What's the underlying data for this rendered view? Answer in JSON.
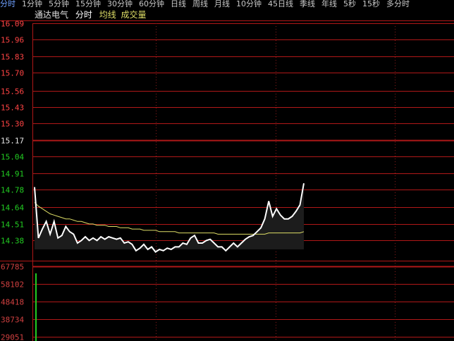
{
  "colors": {
    "grid": "#b01818",
    "dotted": "#8a1a1a",
    "price_up": "#ff4444",
    "price_down": "#22cc22",
    "ref": "#e8e8e8",
    "volume_tick": "#d04040",
    "price_line": "#ffffff",
    "avg_line": "#dddd66",
    "volume_bar": "#22cc22",
    "active_tab": "#6fa0ff"
  },
  "tabs": [
    "分时",
    "1分钟",
    "5分钟",
    "15分钟",
    "30分钟",
    "60分钟",
    "日线",
    "周线",
    "月线",
    "10分钟",
    "45日线",
    "季线",
    "年线",
    "5秒",
    "15秒",
    "多分时"
  ],
  "active_tab": 0,
  "legend": {
    "name": "通达电气",
    "mode": "分时",
    "avg": "均线",
    "vol": "成交量"
  },
  "chart_data": {
    "type": "line",
    "price_axis": {
      "ticks": [
        "16.09",
        "15.96",
        "15.83",
        "15.70",
        "15.56",
        "15.43",
        "15.30",
        "15.17",
        "15.04",
        "14.91",
        "14.78",
        "14.64",
        "14.51",
        "14.38"
      ],
      "reference_price": 15.17,
      "ylim": [
        14.31,
        16.09
      ]
    },
    "volume_axis": {
      "ticks": [
        "67785",
        "58102",
        "48418",
        "38734",
        "29051"
      ],
      "ylim": [
        0,
        67785
      ]
    },
    "price_series": {
      "name": "分时",
      "x_index": [
        0,
        1,
        2,
        3,
        4,
        5,
        6,
        7,
        8,
        9,
        10,
        11,
        12,
        13,
        14,
        15,
        16,
        17,
        18,
        19,
        20,
        21,
        22,
        23,
        24,
        25,
        26,
        27,
        28,
        29,
        30,
        31,
        32,
        33,
        34,
        35,
        36,
        37,
        38,
        39,
        40,
        41,
        42,
        43,
        44,
        45,
        46,
        47,
        48,
        49,
        50,
        51,
        52,
        53,
        54,
        55,
        56,
        57,
        58,
        59,
        60,
        61,
        62,
        63,
        64,
        65,
        66,
        67,
        68,
        69,
        70,
        71,
        72,
        73,
        74,
        75
      ],
      "values": [
        14.8,
        14.4,
        14.47,
        14.53,
        14.43,
        14.53,
        14.4,
        14.42,
        14.49,
        14.45,
        14.43,
        14.36,
        14.38,
        14.41,
        14.38,
        14.4,
        14.38,
        14.41,
        14.39,
        14.41,
        14.4,
        14.39,
        14.4,
        14.36,
        14.37,
        14.35,
        14.3,
        14.32,
        14.35,
        14.31,
        14.33,
        14.29,
        14.31,
        14.3,
        14.32,
        14.31,
        14.33,
        14.33,
        14.36,
        14.35,
        14.4,
        14.42,
        14.36,
        14.36,
        14.38,
        14.39,
        14.36,
        14.33,
        14.33,
        14.3,
        14.33,
        14.36,
        14.33,
        14.36,
        14.39,
        14.41,
        14.42,
        14.45,
        14.48,
        14.55,
        14.69,
        14.57,
        14.63,
        14.58,
        14.55,
        14.55,
        14.57,
        14.61,
        14.66,
        14.83
      ],
      "x_max": 240
    },
    "avg_series": {
      "name": "均线",
      "values": [
        14.68,
        14.65,
        14.63,
        14.61,
        14.59,
        14.58,
        14.57,
        14.56,
        14.55,
        14.55,
        14.54,
        14.53,
        14.53,
        14.52,
        14.51,
        14.51,
        14.5,
        14.5,
        14.5,
        14.49,
        14.49,
        14.49,
        14.48,
        14.48,
        14.48,
        14.47,
        14.47,
        14.47,
        14.46,
        14.46,
        14.46,
        14.46,
        14.45,
        14.45,
        14.45,
        14.45,
        14.45,
        14.44,
        14.44,
        14.44,
        14.44,
        14.44,
        14.44,
        14.44,
        14.44,
        14.44,
        14.44,
        14.43,
        14.43,
        14.43,
        14.43,
        14.43,
        14.43,
        14.43,
        14.43,
        14.43,
        14.43,
        14.43,
        14.43,
        14.43,
        14.44,
        14.44,
        14.44,
        14.44,
        14.44,
        14.44,
        14.44,
        14.44,
        14.44,
        14.45
      ]
    },
    "volume_series": {
      "name": "成交量",
      "values": [
        62000
      ]
    }
  }
}
